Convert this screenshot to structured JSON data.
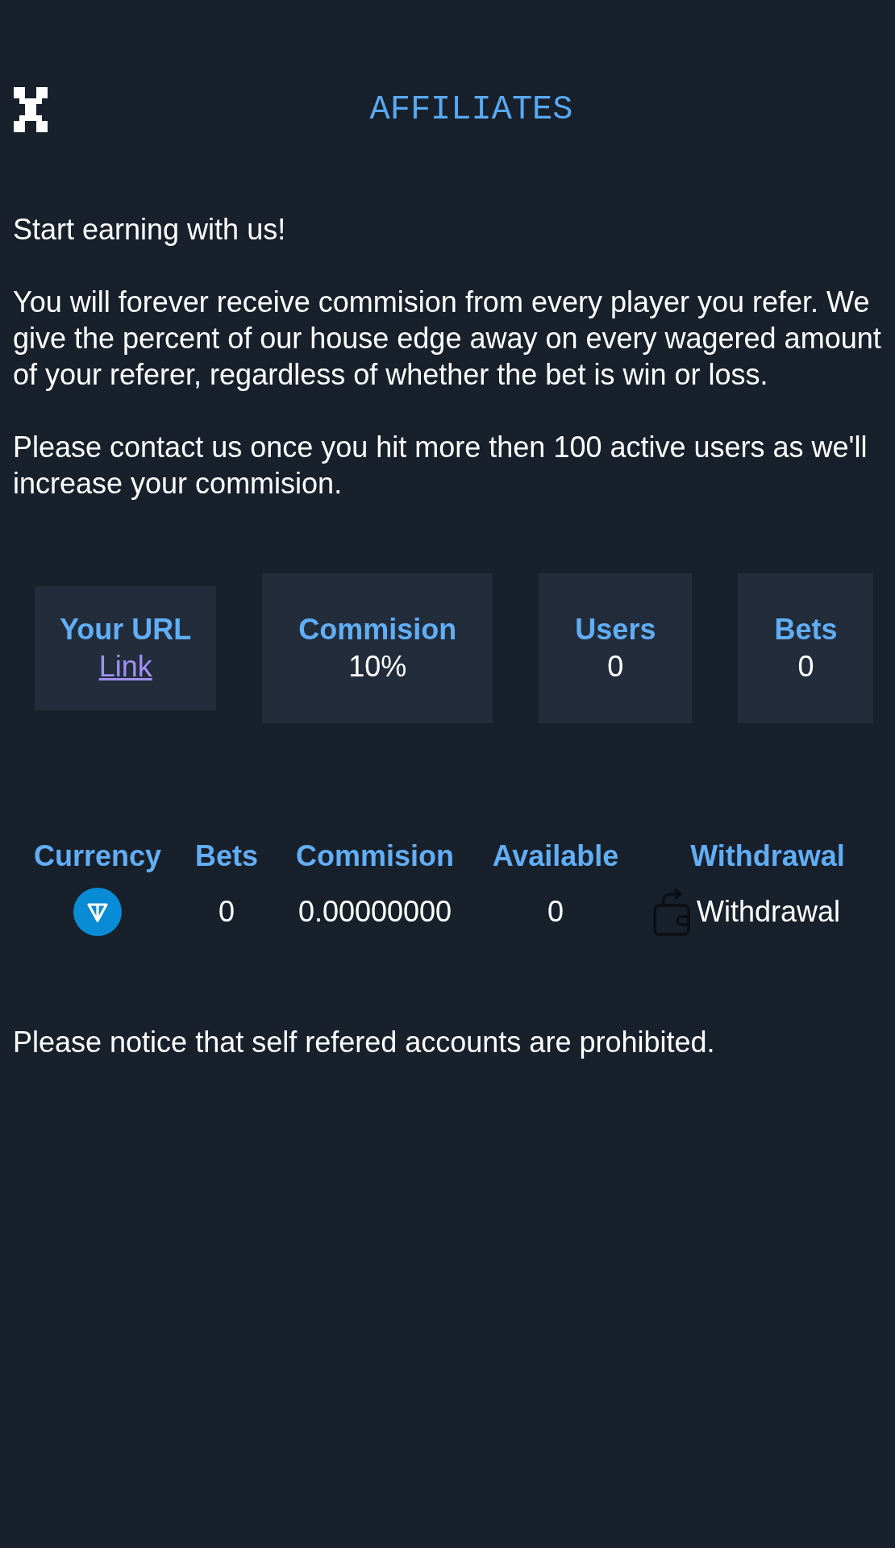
{
  "header": {
    "title": "AFFILIATES"
  },
  "intro": {
    "headline": "Start earning with us!",
    "paragraphs": [
      "You will forever receive commision from every player you refer. We give the percent of our house edge away on every wagered amount of your referer, regardless of whether the bet is win or loss.",
      "Please contact us once you hit more then 100 active users as we'll increase your commision."
    ]
  },
  "stats": [
    {
      "kind": "link",
      "label": "Your URL",
      "value": "Link"
    },
    {
      "kind": "value",
      "label": "Commision",
      "value": "10%"
    },
    {
      "kind": "value",
      "label": "Users",
      "value": "0"
    },
    {
      "kind": "value",
      "label": "Bets",
      "value": "0"
    }
  ],
  "earnings_table": {
    "columns": [
      "Currency",
      "Bets",
      "Commision",
      "Available",
      "Withdrawal"
    ],
    "rows": [
      {
        "bets": "0",
        "commision": "0.00000000",
        "available": "0",
        "withdrawal": "Withdrawal"
      }
    ]
  },
  "notice": "Please notice that self refered accounts are prohibited."
}
